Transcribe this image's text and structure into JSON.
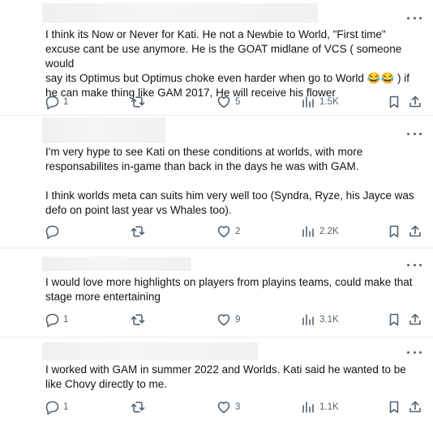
{
  "posts": [
    {
      "text": "I think its Now or Never for Kati. He not a Newbie to World, \"First time\"\nexcuse cant be use anymore. He is the GOAT midlane of VCS ( someone would\nsay its Optimus but Optimus choke even harder when go to World 😂😂 ) if\nhe can make thing like GAM 2017, He will receive his flower",
      "replies": "1",
      "reposts": "",
      "likes": "5",
      "views": "1.5K"
    },
    {
      "text": "I'm very hype to see Kati on these conditions at worlds, with more\nresponsabilites in-game than back in the days he was with GAM.\n\nI think worlds meta can suits him very well too (Syndra, Ryze, his Jayce was\ndefo on point last year vs Whales too).",
      "replies": "",
      "reposts": "",
      "likes": "2",
      "views": "2.2K"
    },
    {
      "text": "I would love more highlights on players from playins teams, could make that\nstage more entertaining",
      "replies": "1",
      "reposts": "",
      "likes": "9",
      "views": "3.1K"
    },
    {
      "text": "I worked with GAM in summer 2022 and Worlds. Kati said he wanted to be\nlike Chovy directly to me.",
      "replies": "1",
      "reposts": "",
      "likes": "3",
      "views": "1.1K"
    }
  ],
  "icons": [
    "more-icon",
    "reply-icon",
    "repost-icon",
    "like-icon",
    "views-icon",
    "bookmark-icon",
    "share-icon"
  ],
  "colors": {
    "text": "#0f1419",
    "muted": "#536471",
    "divider": "#e6ecf0",
    "redacted": "#f1f1f1"
  }
}
